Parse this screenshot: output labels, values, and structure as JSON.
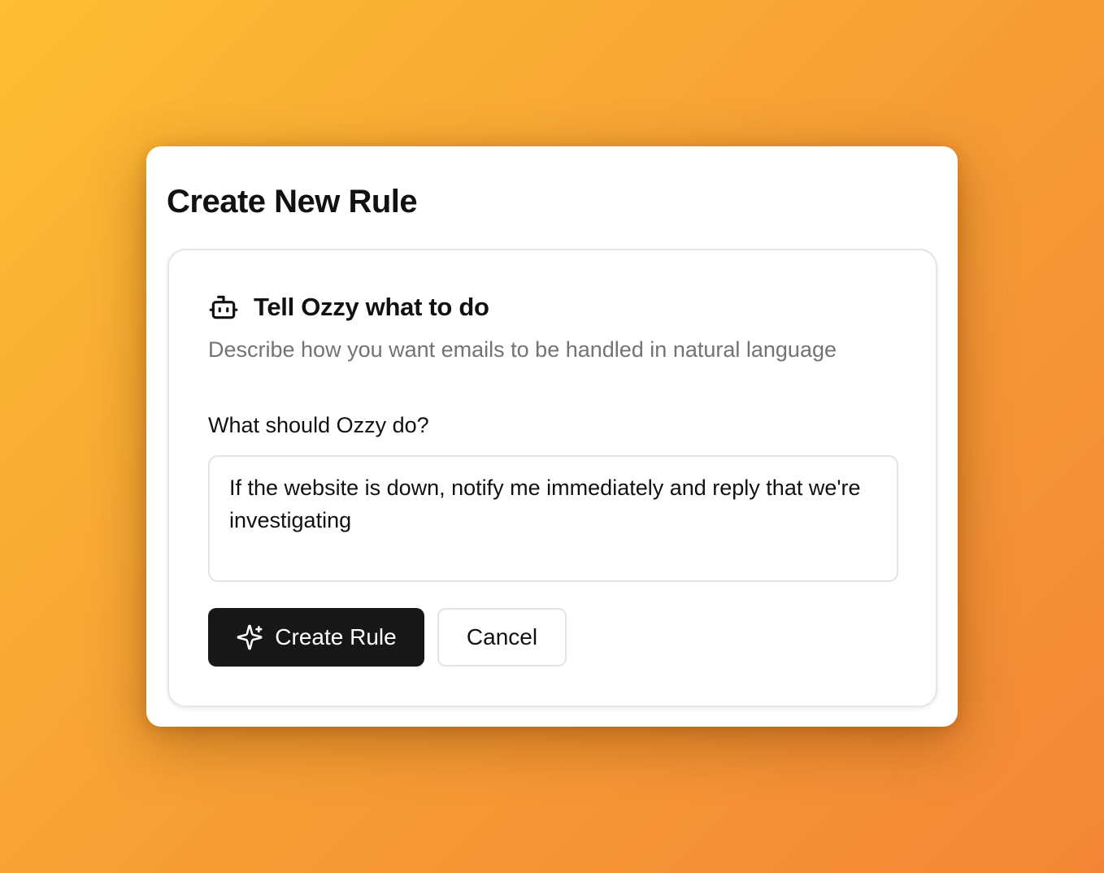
{
  "dialog": {
    "title": "Create New Rule"
  },
  "card": {
    "icon": "bot-icon",
    "title": "Tell Ozzy what to do",
    "description": "Describe how you want emails to be handled in natural language"
  },
  "form": {
    "label": "What should Ozzy do?",
    "value": "If the website is down, notify me immediately and reply that we're investigating"
  },
  "actions": {
    "create_label": "Create Rule",
    "create_icon": "sparkles-icon",
    "cancel_label": "Cancel"
  },
  "colors": {
    "background_start": "#fdbe33",
    "background_end": "#f38636",
    "primary_button": "#171717",
    "muted_text": "#737373"
  }
}
